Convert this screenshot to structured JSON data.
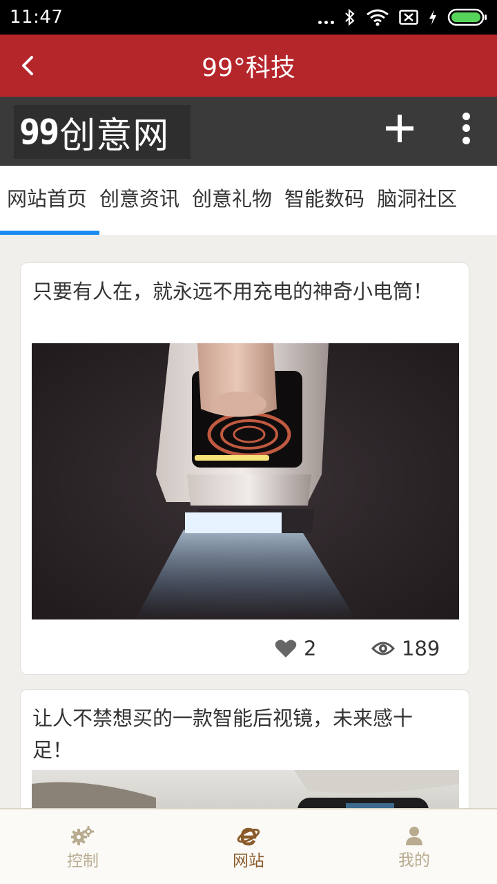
{
  "status_bar": {
    "time": "11:47"
  },
  "header": {
    "title": "99°科技"
  },
  "site_bar": {
    "logo_digits": "99",
    "logo_text": "创意网"
  },
  "tabs": [
    {
      "label": "网站首页",
      "active": true
    },
    {
      "label": "创意资讯",
      "active": false
    },
    {
      "label": "创意礼物",
      "active": false
    },
    {
      "label": "智能数码",
      "active": false
    },
    {
      "label": "脑洞社区",
      "active": false
    }
  ],
  "articles": [
    {
      "title": "只要有人在，就永远不用充电的神奇小电筒！",
      "likes": "2",
      "views": "189"
    },
    {
      "title": "让人不禁想买的一款智能后视镜，未来感十足！"
    }
  ],
  "bottom_nav": [
    {
      "label": "控制",
      "icon": "gears-icon",
      "active": false
    },
    {
      "label": "网站",
      "icon": "ie-icon",
      "active": true
    },
    {
      "label": "我的",
      "icon": "user-icon",
      "active": false
    }
  ],
  "colors": {
    "header_red": "#b5262b",
    "tab_indicator": "#1a8cf0",
    "nav_active": "#8a5a2a",
    "nav_inactive": "#b9ab90"
  }
}
